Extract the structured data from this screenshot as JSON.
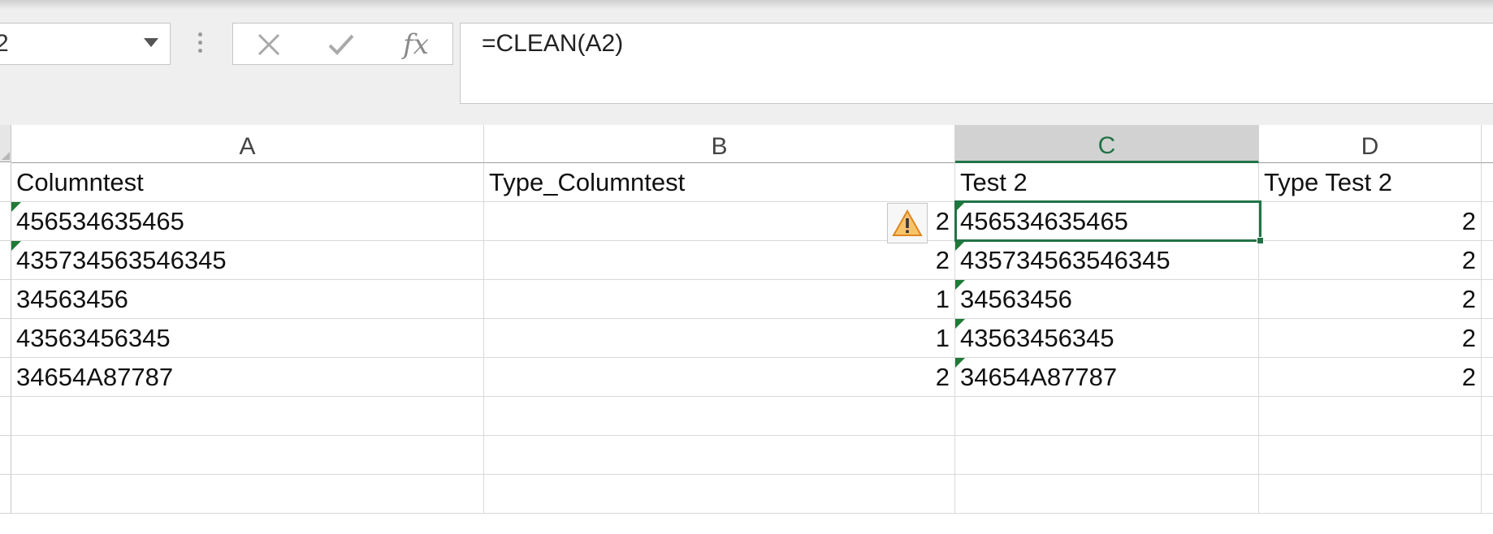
{
  "name_box": {
    "value": "2"
  },
  "formula_bar": {
    "cancel_icon": "x-icon",
    "enter_icon": "checkmark-icon",
    "function_label": "fx",
    "formula": "=CLEAN(A2)"
  },
  "columns": [
    {
      "label": "A"
    },
    {
      "label": "B"
    },
    {
      "label": "C",
      "active": true
    },
    {
      "label": "D"
    }
  ],
  "rows": [
    {
      "a": "Columntest",
      "b": "Type_Columntest",
      "c": "Test 2",
      "d": "Type Test 2"
    },
    {
      "a": "456534635465",
      "b": "2",
      "c": "456534635465",
      "d": "2"
    },
    {
      "a": "435734563546345",
      "b": "2",
      "c": "435734563546345",
      "d": "2"
    },
    {
      "a": "34563456",
      "b": "1",
      "c": "34563456",
      "d": "2"
    },
    {
      "a": "43563456345",
      "b": "1",
      "c": "43563456345",
      "d": "2"
    },
    {
      "a": "34654A87787",
      "b": "2",
      "c": "34654A87787",
      "d": "2"
    },
    {
      "a": "",
      "b": "",
      "c": "",
      "d": ""
    },
    {
      "a": "",
      "b": "",
      "c": "",
      "d": ""
    },
    {
      "a": "",
      "b": "",
      "c": "",
      "d": ""
    }
  ],
  "error_indicator": {
    "icon": "warning-icon",
    "color": "#f0a030"
  },
  "colors": {
    "accent": "#217346",
    "flag": "#1f7a37"
  }
}
